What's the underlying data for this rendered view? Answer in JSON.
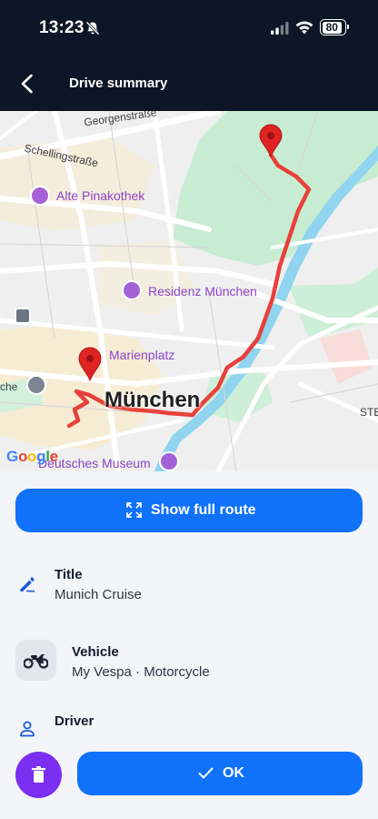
{
  "status_bar": {
    "time": "13:23",
    "battery_level": "80"
  },
  "nav": {
    "title": "Drive summary"
  },
  "map": {
    "street_labels": [
      "Georgenstraße",
      "Schellingstraße",
      "che",
      "STE"
    ],
    "poi_labels": [
      "Alte Pinakothek",
      "Residenz München",
      "Marienplatz",
      "Deutsches Museum"
    ],
    "city_label": "München",
    "attribution": "Google",
    "colors": {
      "route": "#e8403a",
      "pin": "#e02323",
      "water": "#90d4ef",
      "park": "#c8ecd2"
    }
  },
  "actions": {
    "full_route_label": "Show full route",
    "ok_label": "OK"
  },
  "details": {
    "title_label": "Title",
    "title_value": "Munich Cruise",
    "vehicle_label": "Vehicle",
    "vehicle_value": "My Vespa · Motorcycle",
    "driver_label": "Driver"
  },
  "colors": {
    "primary": "#1071fb",
    "danger": "#7b2ff1",
    "header": "#0c1626"
  }
}
